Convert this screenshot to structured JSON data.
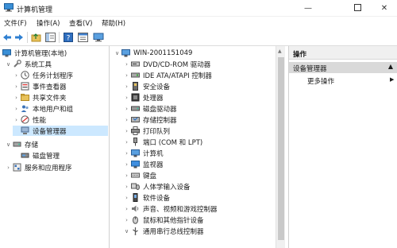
{
  "window": {
    "title": "计算机管理"
  },
  "menu": [
    "文件(F)",
    "操作(A)",
    "查看(V)",
    "帮助(H)"
  ],
  "left_tree": [
    {
      "label": "计算机管理(本地)",
      "exp": "",
      "icon": "computer-management-icon",
      "indent": 0
    },
    {
      "label": "系统工具",
      "exp": "v",
      "icon": "system-tools-icon",
      "indent": 1
    },
    {
      "label": "任务计划程序",
      "exp": ">",
      "icon": "task-scheduler-icon",
      "indent": 2
    },
    {
      "label": "事件查看器",
      "exp": ">",
      "icon": "event-viewer-icon",
      "indent": 2
    },
    {
      "label": "共享文件夹",
      "exp": ">",
      "icon": "shared-folders-icon",
      "indent": 2
    },
    {
      "label": "本地用户和组",
      "exp": ">",
      "icon": "local-users-icon",
      "indent": 2
    },
    {
      "label": "性能",
      "exp": ">",
      "icon": "performance-icon",
      "indent": 2
    },
    {
      "label": "设备管理器",
      "exp": "",
      "icon": "device-manager-icon",
      "indent": 2,
      "selected": true
    },
    {
      "label": "存储",
      "exp": "v",
      "icon": "storage-icon",
      "indent": 1
    },
    {
      "label": "磁盘管理",
      "exp": "",
      "icon": "disk-management-icon",
      "indent": 2
    },
    {
      "label": "服务和应用程序",
      "exp": ">",
      "icon": "services-apps-icon",
      "indent": 1
    }
  ],
  "devices": {
    "root": "WIN-2001151049",
    "items": [
      {
        "label": "DVD/CD-ROM 驱动器",
        "exp": ">",
        "icon": "dvd-icon"
      },
      {
        "label": "IDE ATA/ATAPI 控制器",
        "exp": ">",
        "icon": "ide-icon"
      },
      {
        "label": "安全设备",
        "exp": ">",
        "icon": "security-device-icon"
      },
      {
        "label": "处理器",
        "exp": ">",
        "icon": "processor-icon"
      },
      {
        "label": "磁盘驱动器",
        "exp": ">",
        "icon": "disk-drive-icon"
      },
      {
        "label": "存储控制器",
        "exp": ">",
        "icon": "storage-controller-icon"
      },
      {
        "label": "打印队列",
        "exp": ">",
        "icon": "print-queue-icon"
      },
      {
        "label": "端口 (COM 和 LPT)",
        "exp": ">",
        "icon": "port-icon"
      },
      {
        "label": "计算机",
        "exp": ">",
        "icon": "computer-icon"
      },
      {
        "label": "监视器",
        "exp": ">",
        "icon": "monitor-icon"
      },
      {
        "label": "键盘",
        "exp": ">",
        "icon": "keyboard-icon"
      },
      {
        "label": "人体学输入设备",
        "exp": ">",
        "icon": "hid-icon"
      },
      {
        "label": "软件设备",
        "exp": ">",
        "icon": "software-device-icon"
      },
      {
        "label": "声音、视频和游戏控制器",
        "exp": ">",
        "icon": "sound-icon"
      },
      {
        "label": "鼠标和其他指针设备",
        "exp": ">",
        "icon": "mouse-icon"
      },
      {
        "label": "通用串行总线控制器",
        "exp": "v",
        "icon": "usb-icon"
      }
    ]
  },
  "actions": {
    "header": "操作",
    "selected": "设备管理器",
    "more": "更多操作"
  }
}
